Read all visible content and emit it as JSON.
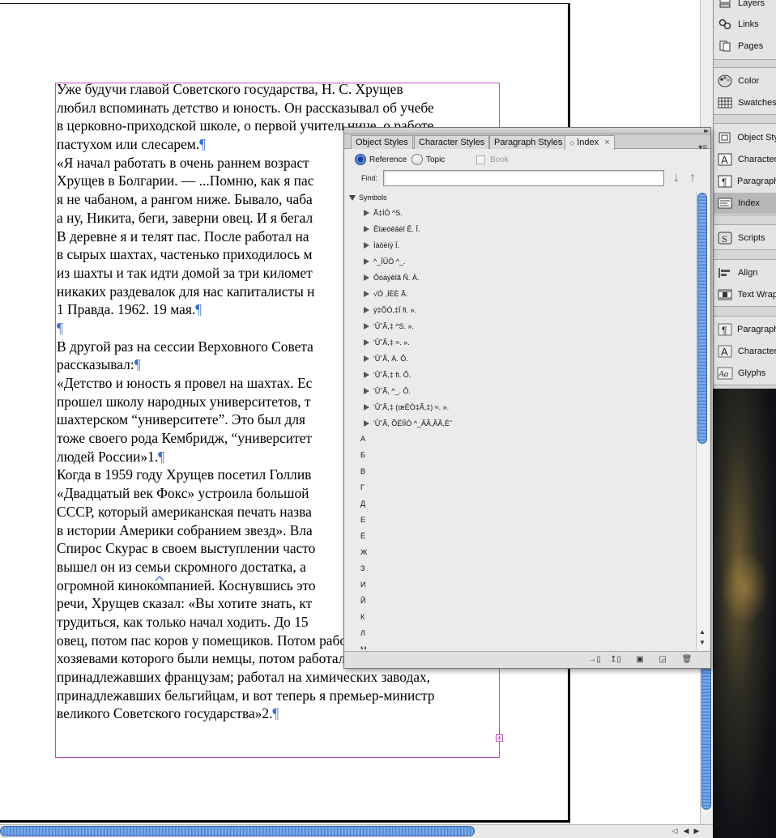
{
  "document": {
    "lines": [
      "Уже будучи главой Советского государства, Н. С. Хрущев",
      "любил вспоминать детство и юность. Он рассказывал об учебе",
      "в церковно-приходской школе, о первой учительнице, о работе",
      "пастухом или слесарем.¶",
      "«Я начал работать в очень раннем возраст",
      "Хрущев в Болгарии. — ...Помню, как я пас",
      "я не чабаном, а рангом ниже. Бывало, чаба",
      "а ну, Никита, беги, заверни овец. И я бегал",
      "В деревне я и телят пас. После работал на",
      "в сырых шахтах, частенько приходилось м",
      "из шахты и так идти домой за три километ",
      "никаких раздевалок для нас капиталисты н",
      "1 Правда. 1962. 19 мая.¶",
      "¶",
      "В другой раз на сессии Верховного Совета",
      "рассказывал:¶",
      "«Детство и юность я провел на шахтах. Ес",
      "прошел школу народных университетов, т",
      "шахтерском “университете”. Это был для",
      "тоже своего рода Кембридж, “университет",
      "людей России»1.¶",
      "Когда в 1959 году Хрущев посетил Голлив",
      "«Двадцатый век Фокс» устроила большой",
      "СССР, который американская печать назва",
      "в истории Америки собранием звезд». Вла",
      "Спирос Скурас в своем выступлении часто",
      "вышел он из семьи скромного достатка, а",
      "огромной кинокомпанией. Коснувшись это",
      "речи, Хрущев сказал: «Вы хотите знать, кт",
      "трудиться, как только начал ходить. До 15",
      "овец, потом пас коров у помещиков. Потом работал на заводе,",
      "хозяевами которого были немцы, потом работал на шахтах,",
      "принадлежавших французам; работал на химических заводах,",
      "принадлежавших бельгийцам, и вот теперь я премьер-министр",
      "великого Советского государства»2.¶"
    ]
  },
  "dock": {
    "items": [
      {
        "label": "Layers",
        "icon": "layers-icon"
      },
      {
        "label": "Links",
        "icon": "links-icon"
      },
      {
        "label": "Pages",
        "icon": "pages-icon"
      },
      {
        "label": "Color",
        "icon": "color-icon"
      },
      {
        "label": "Swatches",
        "icon": "swatches-icon"
      },
      {
        "label": "Object Sty",
        "icon": "object-styles-icon"
      },
      {
        "label": "Character",
        "icon": "character-styles-icon"
      },
      {
        "label": "Paragraph",
        "icon": "paragraph-styles-icon"
      },
      {
        "label": "Index",
        "icon": "index-icon"
      },
      {
        "label": "Scripts",
        "icon": "scripts-icon"
      },
      {
        "label": "Align",
        "icon": "align-icon"
      },
      {
        "label": "Text Wrap",
        "icon": "text-wrap-icon"
      },
      {
        "label": "Paragraph",
        "icon": "paragraph-icon"
      },
      {
        "label": "Character",
        "icon": "character-icon"
      },
      {
        "label": "Glyphs",
        "icon": "glyphs-icon"
      }
    ]
  },
  "panel": {
    "tabs": [
      "Object Styles",
      "Character Styles",
      "Paragraph Styles",
      "Index"
    ],
    "active_tab": "Index",
    "tab_close": "×",
    "mode_reference": "Reference",
    "mode_topic": "Topic",
    "book_label": "Book",
    "find_label": "Find:",
    "find_value": "",
    "root_label": "Symbols",
    "entries": [
      "Ã‡ÌÒ ^S.",
      "Êîæóêâèî Ê. Î.",
      "Ìàöèíý Ï.",
      "^_ÎÛÒ ^_.",
      "Ôóàýêîã Ñ. À.",
      "√Ó ,ÍÈÈ Ã.",
      "ý‡ÕÓ,‡Ï ﬁ. ».",
      "'Û˘Ã,‡ ^S. ».",
      "'Û˘Ã,‡ ≈. ».",
      "'Û˘Ã, À. Ô.",
      "'Û˘Ã,‡ ﬁ. Ô.",
      "'Û˘Ã, ^_. Ô.",
      "'Û˘Ã,‡ (œÈÒ‡Ã,‡) ≈. ».",
      "'Û˘Ã, ÕËÍÌÓ ^_ÃÃ,ÃÃ,È˜"
    ],
    "letters": [
      "А",
      "Б",
      "В",
      "Г",
      "Д",
      "Е",
      "Ё",
      "Ж",
      "З",
      "И",
      "Й",
      "К",
      "Л",
      "М"
    ]
  },
  "colors": {
    "frame_border": "#c04fc0",
    "scroll_thumb": "#5a8fd8",
    "pilcrow": "#3a6fd0"
  }
}
